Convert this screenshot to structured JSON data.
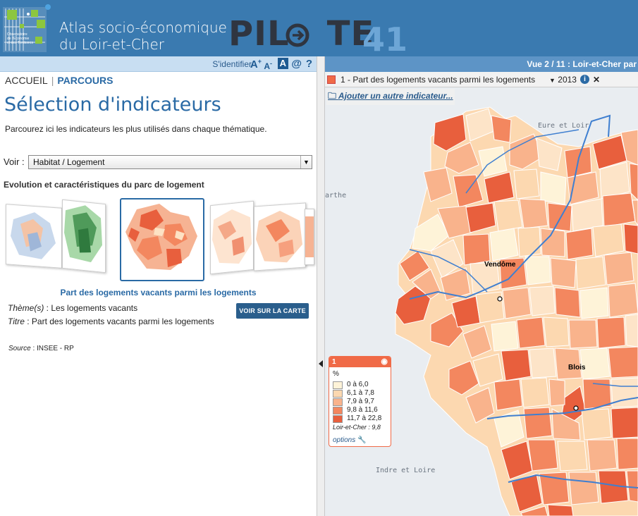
{
  "header": {
    "title_line1": "Atlas socio-économique",
    "title_line2": "du Loir-et-Cher",
    "brand_word": "PIL   TE",
    "brand_number": "41",
    "colors": {
      "header_bg": "#3a7ab0",
      "accent": "#2a6aa5",
      "brand_number": "#6da6d6"
    }
  },
  "toolbar": {
    "login": "S'identifier",
    "font_larger": "A+",
    "font_smaller": "A-",
    "contrast": "A",
    "contact": "@",
    "help": "?"
  },
  "breadcrumb": {
    "home": "ACCUEIL",
    "current": "PARCOURS"
  },
  "page": {
    "title": "Sélection d'indicateurs",
    "intro": "Parcourez ici les indicateurs les plus utilisés dans chaque thématique.",
    "voir_label": "Voir :",
    "theme_selected": "Habitat / Logement",
    "section_title": "Evolution et caractéristiques du parc de logement"
  },
  "indicator": {
    "name": "Part des logements vacants parmi les logements",
    "theme_label": "Thème(s)",
    "theme_value": " : Les logements vacants",
    "titre_label": "Titre",
    "titre_value": " : Part des logements vacants parmi les logements",
    "button": "VOIR SUR LA CARTE",
    "source_label": "Source",
    "source_value": " : INSEE - RP"
  },
  "map": {
    "view_bar": "Vue 2 / 11 : Loir-et-Cher par",
    "layer_label": "1 - Part des logements vacants parmi les logements",
    "year": "2013",
    "add_indicator": "Ajouter un autre indicateur...",
    "regions": {
      "eure_et_loir": "Eure et Loir",
      "sarthe": "arthe",
      "indre_et_loire": "Indre et Loire"
    },
    "cities": {
      "vendome": "Vendôme",
      "blois": "Blois"
    }
  },
  "legend": {
    "number": "1",
    "unit": "%",
    "classes": [
      {
        "label": "0 à 6,0",
        "color": "#fef3d8"
      },
      {
        "label": "6,1 à 7,8",
        "color": "#fcd8b0"
      },
      {
        "label": "7,9 à 9,7",
        "color": "#f9b38c"
      },
      {
        "label": "9,8 à 11,6",
        "color": "#f3875f"
      },
      {
        "label": "11,7 à 22,8",
        "color": "#e85f3d"
      }
    ],
    "reference": "Loir-et-Cher : 9,8",
    "options": "options"
  }
}
